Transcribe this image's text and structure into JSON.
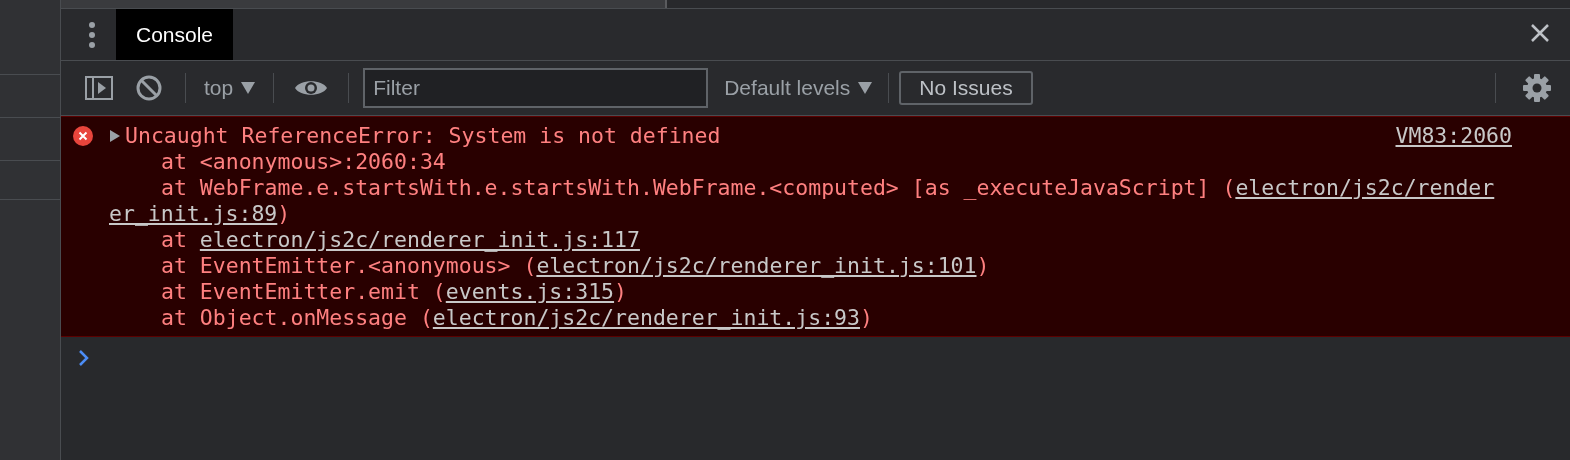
{
  "tabs": [
    {
      "label": "Console",
      "selected": true
    }
  ],
  "toolbar": {
    "context": "top",
    "filter": {
      "placeholder": "Filter"
    },
    "levels": "Default levels",
    "issues": "No Issues"
  },
  "messages": [
    {
      "kind": "error",
      "expanded": false,
      "summary": "Uncaught ReferenceError: System is not defined",
      "source": "VM83:2060",
      "lines": [
        {
          "kind": "frame",
          "segments": [
            {
              "text": "at <anonymous>:2060:34",
              "link": false
            }
          ]
        },
        {
          "kind": "frame",
          "segments": [
            {
              "text": "at WebFrame.e.startsWith.e.startsWith.WebFrame.<computed> [as _executeJavaScript] (",
              "link": false
            },
            {
              "text": "electron/js2c/render",
              "link": true
            }
          ]
        },
        {
          "kind": "wrap",
          "segments": [
            {
              "text": "er_init.js:89",
              "link": true
            },
            {
              "text": ")",
              "link": false
            }
          ]
        },
        {
          "kind": "frame",
          "segments": [
            {
              "text": "at ",
              "link": false
            },
            {
              "text": "electron/js2c/renderer_init.js:117",
              "link": true
            }
          ]
        },
        {
          "kind": "frame",
          "segments": [
            {
              "text": "at EventEmitter.<anonymous> (",
              "link": false
            },
            {
              "text": "electron/js2c/renderer_init.js:101",
              "link": true
            },
            {
              "text": ")",
              "link": false
            }
          ]
        },
        {
          "kind": "frame",
          "segments": [
            {
              "text": "at EventEmitter.emit (",
              "link": false
            },
            {
              "text": "events.js:315",
              "link": true
            },
            {
              "text": ")",
              "link": false
            }
          ]
        },
        {
          "kind": "frame",
          "segments": [
            {
              "text": "at Object.onMessage (",
              "link": false
            },
            {
              "text": "electron/js2c/renderer_init.js:93",
              "link": true
            },
            {
              "text": ")",
              "link": false
            }
          ]
        }
      ]
    }
  ]
}
